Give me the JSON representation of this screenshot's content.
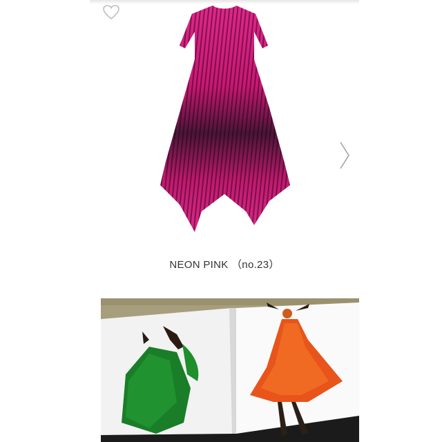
{
  "product": {
    "caption": "NEON PINK （no.23）",
    "favorite_icon": "heart-outline-icon",
    "next_icon": "chevron-right-icon"
  },
  "colors": {
    "dress_pink": "#d8187a",
    "dress_dark": "#3a0f2c",
    "photo_green": "#1f8a2e",
    "photo_orange": "#e8561a",
    "floor": "#a89f7e"
  }
}
